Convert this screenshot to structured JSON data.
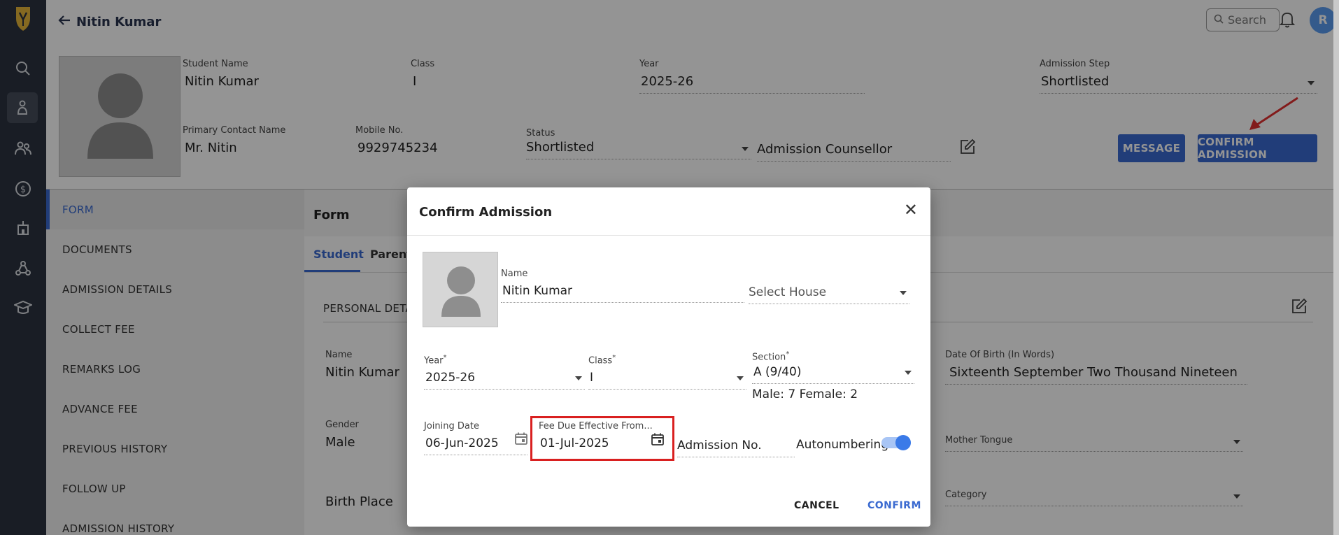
{
  "header": {
    "student_name": "Nitin Kumar",
    "search_placeholder": "Search",
    "avatar_initial": "R"
  },
  "profile": {
    "student_name_label": "Student Name",
    "student_name": "Nitin Kumar",
    "class_label": "Class",
    "class": "I",
    "year_label": "Year",
    "year": "2025-26",
    "admission_step_label": "Admission Step",
    "admission_step": "Shortlisted",
    "primary_contact_label": "Primary Contact Name",
    "primary_contact": "Mr. Nitin",
    "mobile_label": "Mobile No.",
    "mobile": "9929745234",
    "status_label": "Status",
    "status": "Shortlisted",
    "counsellor_placeholder": "Admission Counsellor"
  },
  "actions": {
    "message": "MESSAGE",
    "confirm_admission": "CONFIRM ADMISSION"
  },
  "leftnav": [
    "FORM",
    "DOCUMENTS",
    "ADMISSION DETAILS",
    "COLLECT FEE",
    "REMARKS LOG",
    "ADVANCE FEE",
    "PREVIOUS HISTORY",
    "FOLLOW UP",
    "ADMISSION HISTORY"
  ],
  "content": {
    "title": "Form",
    "tabs": [
      "Student",
      "Parent"
    ],
    "section": "PERSONAL DETA",
    "name_label": "Name",
    "name_value": "Nitin  Kumar",
    "gender_label": "Gender",
    "gender_value": "Male",
    "birth_place_placeholder": "Birth Place",
    "dob_words_label": "Date Of Birth (In Words)",
    "dob_words_value": "Sixteenth September  Two Thousand Nineteen",
    "mother_tongue_placeholder": "Mother Tongue",
    "category_placeholder": "Category"
  },
  "modal": {
    "title": "Confirm Admission",
    "name_label": "Name",
    "name_value": "Nitin Kumar",
    "house_placeholder": "Select House",
    "year_label": "Year",
    "year_value": "2025-26",
    "class_label": "Class",
    "class_value": "I",
    "section_label": "Section",
    "section_value": "A (9/40)",
    "gender_counts": "Male: 7 Female: 2",
    "joining_label": "Joining Date",
    "joining_value": "06-Jun-2025",
    "fee_due_label": "Fee Due Effective From...",
    "fee_due_value": "01-Jul-2025",
    "admission_no_placeholder": "Admission No.",
    "autonumbering_label": "Autonumbering",
    "autonumbering_on": true,
    "cancel": "CANCEL",
    "confirm": "CONFIRM"
  },
  "colors": {
    "accent": "#3a6ad0",
    "sidebar": "#2c3341",
    "highlight": "#d92020"
  }
}
